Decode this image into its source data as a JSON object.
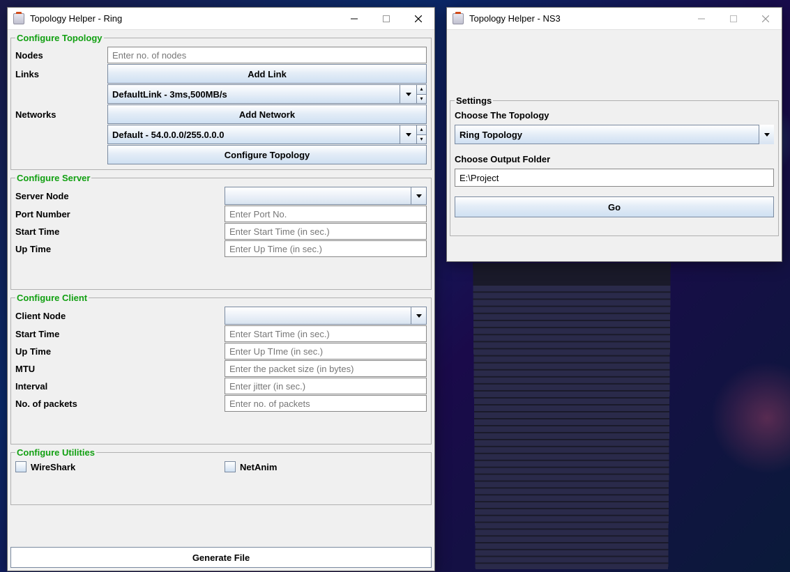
{
  "ring_window": {
    "title": "Topology Helper - Ring",
    "topology": {
      "legend": "Configure Topology",
      "nodes_label": "Nodes",
      "nodes_placeholder": "Enter no. of nodes",
      "links_label": "Links",
      "add_link_btn": "Add Link",
      "link_value": "DefaultLink - 3ms,500MB/s",
      "networks_label": "Networks",
      "add_network_btn": "Add Network",
      "network_value": "Default - 54.0.0.0/255.0.0.0",
      "configure_btn": "Configure Topology"
    },
    "server": {
      "legend": "Configure Server",
      "node_label": "Server Node",
      "port_label": "Port Number",
      "port_placeholder": "Enter Port No.",
      "start_label": "Start Time",
      "start_placeholder": "Enter Start Time (in sec.)",
      "up_label": "Up Time",
      "up_placeholder": "Enter Up Time (in sec.)"
    },
    "client": {
      "legend": "Configure Client",
      "node_label": "Client Node",
      "start_label": "Start Time",
      "start_placeholder": "Enter Start Time (in sec.)",
      "up_label": "Up Time",
      "up_placeholder": "Enter Up TIme (in sec.)",
      "mtu_label": "MTU",
      "mtu_placeholder": "Enter the packet size (in bytes)",
      "interval_label": "Interval",
      "interval_placeholder": "Enter jitter (in sec.)",
      "packets_label": "No. of packets",
      "packets_placeholder": "Enter no. of packets"
    },
    "utilities": {
      "legend": "Configure Utilities",
      "wireshark": "WireShark",
      "netanim": "NetAnim"
    },
    "generate_btn": "Generate File"
  },
  "ns3_window": {
    "title": "Topology Helper - NS3",
    "settings": {
      "legend": "Settings",
      "topology_label": "Choose The Topology",
      "topology_value": "Ring Topology",
      "folder_label": "Choose Output Folder",
      "folder_value": "E:\\Project",
      "go_btn": "Go"
    }
  }
}
